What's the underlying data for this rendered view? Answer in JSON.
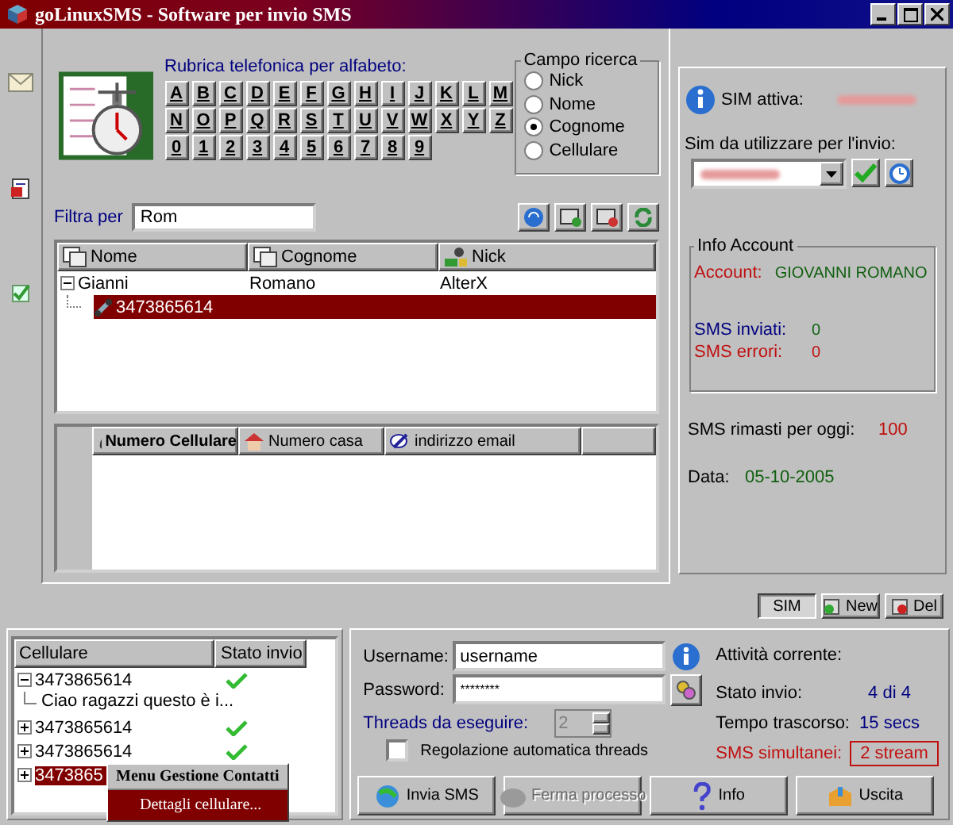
{
  "window": {
    "title": "goLinuxSMS - Software per invio SMS"
  },
  "alphabet": {
    "label": "Rubrica telefonica per alfabeto:",
    "keys": [
      "A",
      "B",
      "C",
      "D",
      "E",
      "F",
      "G",
      "H",
      "I",
      "J",
      "K",
      "L",
      "M",
      "N",
      "O",
      "P",
      "Q",
      "R",
      "S",
      "T",
      "U",
      "V",
      "W",
      "X",
      "Y",
      "Z",
      "0",
      "1",
      "2",
      "3",
      "4",
      "5",
      "6",
      "7",
      "8",
      "9"
    ]
  },
  "search_field": {
    "title": "Campo ricerca",
    "options": [
      {
        "label": "Nick",
        "selected": false
      },
      {
        "label": "Nome",
        "selected": false
      },
      {
        "label": "Cognome",
        "selected": true
      },
      {
        "label": "Cellulare",
        "selected": false
      }
    ]
  },
  "filter": {
    "label": "Filtra per",
    "value": "Rom"
  },
  "contacts": {
    "columns": [
      "Nome",
      "Cognome",
      "Nick"
    ],
    "rows": [
      {
        "nome": "Gianni",
        "cognome": "Romano",
        "nick": "AlterX",
        "expanded": true,
        "children": [
          {
            "number": "3473865614",
            "selected": true
          }
        ]
      }
    ]
  },
  "details": {
    "columns": [
      "Numero Cellulare",
      "Numero casa",
      "indirizzo email"
    ]
  },
  "sim": {
    "active_label": "SIM attiva:",
    "choose_label": "Sim da utilizzare per l'invio:"
  },
  "account": {
    "title": "Info Account",
    "account_label": "Account:",
    "account_value": "GIOVANNI ROMANO",
    "sent_label": "SMS inviati:",
    "sent": "0",
    "errors_label": "SMS errori:",
    "errors": "0"
  },
  "remaining": {
    "label": "SMS rimasti per oggi:",
    "value": "100"
  },
  "date": {
    "label": "Data:",
    "value": "05-10-2005"
  },
  "tabs": [
    {
      "label": "SIM",
      "selected": true
    },
    {
      "label": "New",
      "selected": false
    },
    {
      "label": "Del",
      "selected": false
    }
  ],
  "queue": {
    "columns": [
      "Cellulare",
      "Stato invio"
    ],
    "items": [
      {
        "number": "3473865614",
        "expanded": true,
        "sent": true,
        "selected": false,
        "children": [
          {
            "text": "Ciao ragazzi questo è i..."
          }
        ]
      },
      {
        "number": "3473865614",
        "expanded": false,
        "sent": true,
        "selected": false
      },
      {
        "number": "3473865614",
        "expanded": false,
        "sent": true,
        "selected": false
      },
      {
        "number": "3473865",
        "expanded": false,
        "selected": true
      }
    ]
  },
  "context_menu": {
    "title": "Menu Gestione Contatti",
    "items": [
      {
        "label": "Dettagli cellulare...",
        "selected": true
      }
    ]
  },
  "login": {
    "username_label": "Username:",
    "username": "username",
    "password_label": "Password:",
    "password": "********"
  },
  "threads": {
    "label": "Threads da eseguire:",
    "value": "2",
    "disabled": true
  },
  "auto_threads": {
    "label": "Regolazione automatica threads",
    "checked": false
  },
  "activity": {
    "title": "Attività corrente:",
    "rows": [
      {
        "label": "Stato invio:",
        "value": "4 di 4",
        "kind": "normal"
      },
      {
        "label": "Tempo trascorso:",
        "value": "15 secs",
        "kind": "normal"
      },
      {
        "label": "SMS simultanei:",
        "value": "2 stream",
        "kind": "alert"
      }
    ]
  },
  "actions": [
    {
      "label": "Invia SMS",
      "disabled": false
    },
    {
      "label": "Ferma processo",
      "disabled": true
    },
    {
      "label": "Info",
      "disabled": false
    },
    {
      "label": "Uscita",
      "disabled": false
    }
  ]
}
